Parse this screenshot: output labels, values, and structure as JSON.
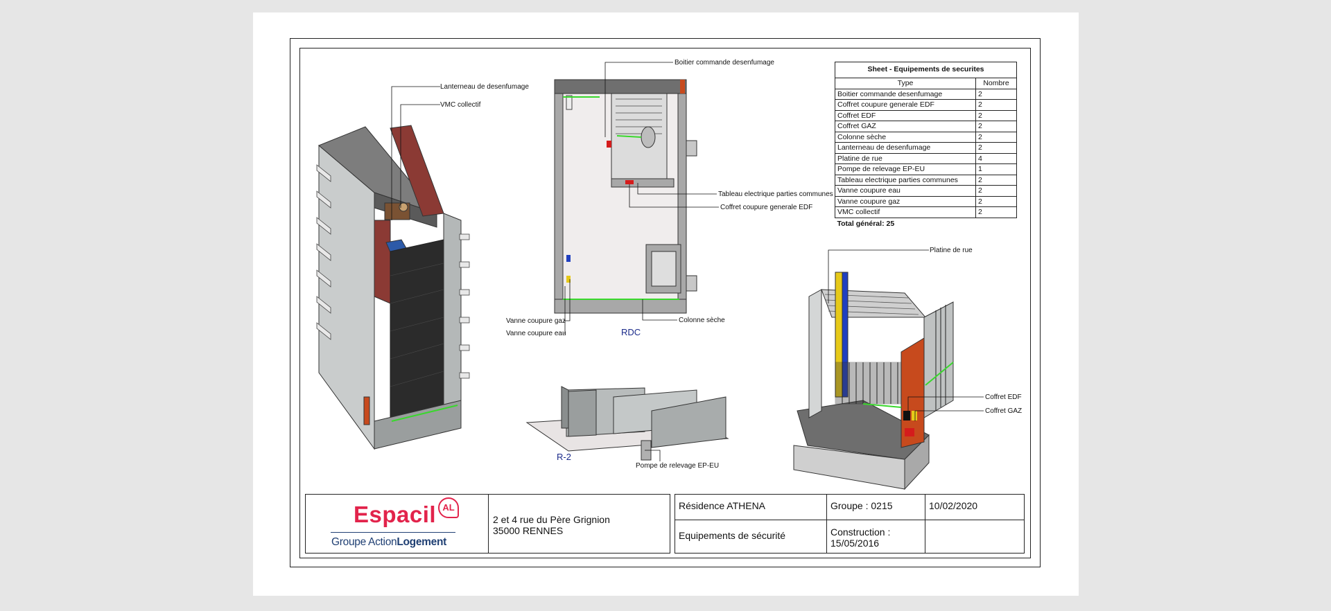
{
  "schedule": {
    "title": "Sheet - Equipements de securites",
    "columns": [
      "Type",
      "Nombre"
    ],
    "rows": [
      {
        "type": "Boitier commande desenfumage",
        "count": "2"
      },
      {
        "type": "Coffret coupure generale EDF",
        "count": "2"
      },
      {
        "type": "Coffret EDF",
        "count": "2"
      },
      {
        "type": "Coffret GAZ",
        "count": "2"
      },
      {
        "type": "Colonne sèche",
        "count": "2"
      },
      {
        "type": "Lanterneau de desenfumage",
        "count": "2"
      },
      {
        "type": "Platine de rue",
        "count": "4"
      },
      {
        "type": "Pompe de relevage EP-EU",
        "count": "1"
      },
      {
        "type": "Tableau electrique parties communes",
        "count": "2"
      },
      {
        "type": "Vanne coupure eau",
        "count": "2"
      },
      {
        "type": "Vanne coupure gaz",
        "count": "2"
      },
      {
        "type": "VMC collectif",
        "count": "2"
      }
    ],
    "total": "Total général: 25"
  },
  "callouts": {
    "lanterneau": "Lanterneau de desenfumage",
    "vmc": "VMC collectif",
    "boitier": "Boitier commande desenfumage",
    "tableau": "Tableau electrique parties communes",
    "coffret_edf_general": "Coffret coupure generale EDF",
    "vanne_gaz": "Vanne coupure gaz",
    "vanne_eau": "Vanne coupure eau",
    "colonne": "Colonne sèche",
    "platine": "Platine de rue",
    "coffret_edf": "Coffret EDF",
    "coffret_gaz": "Coffret GAZ",
    "pompe": "Pompe de relevage EP-EU"
  },
  "views": {
    "rdc": "RDC",
    "r2": "R-2"
  },
  "titleblock": {
    "logo_name": "Espacil",
    "logo_badge": "AL",
    "logo_group_a": "Groupe Action",
    "logo_group_b": "Logement",
    "address_line1": "2 et 4 rue du Père Grignion",
    "address_line2": "35000 RENNES",
    "residence": "Résidence ATHENA",
    "groupe": "Groupe : 0215",
    "date": "10/02/2020",
    "subject": "Equipements de sécurité",
    "construction_label": "Construction :",
    "construction_date": "15/05/2016"
  },
  "colors": {
    "brand_red": "#e2234b",
    "brand_blue": "#1f3f73",
    "view_label": "#1a2a8a"
  }
}
